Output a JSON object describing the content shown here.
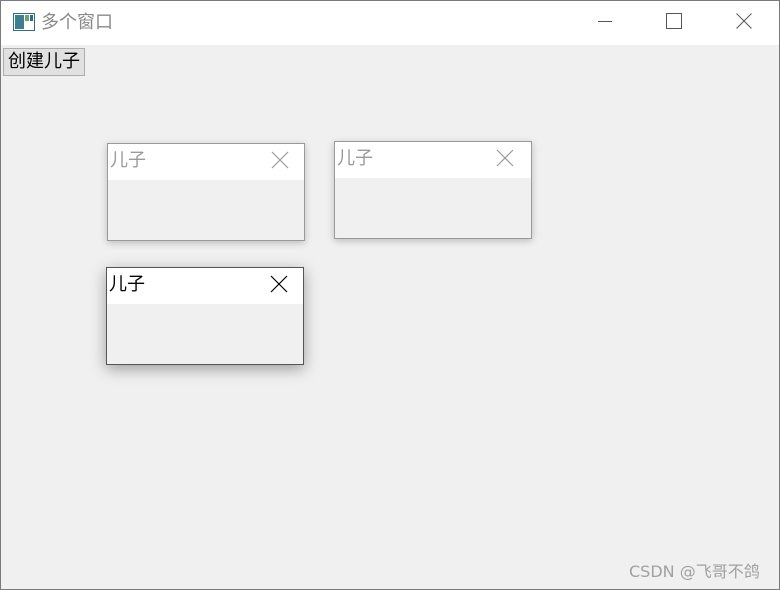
{
  "window": {
    "title": "多个窗口",
    "icon": "app-window-icon",
    "controls": {
      "minimize": "minimize-icon",
      "maximize": "maximize-icon",
      "close": "close-icon"
    }
  },
  "toolbar": {
    "create_label": "创建儿子"
  },
  "children": [
    {
      "title": "儿子",
      "state": "inactive"
    },
    {
      "title": "儿子",
      "state": "inactive"
    },
    {
      "title": "儿子",
      "state": "active"
    }
  ],
  "watermark": {
    "text": "CSDN @飞哥不鸽"
  },
  "colors": {
    "client_background": "#f0f0f0",
    "title_background": "#ffffff",
    "inactive_text": "#9a9a9a",
    "active_text": "#000000"
  }
}
